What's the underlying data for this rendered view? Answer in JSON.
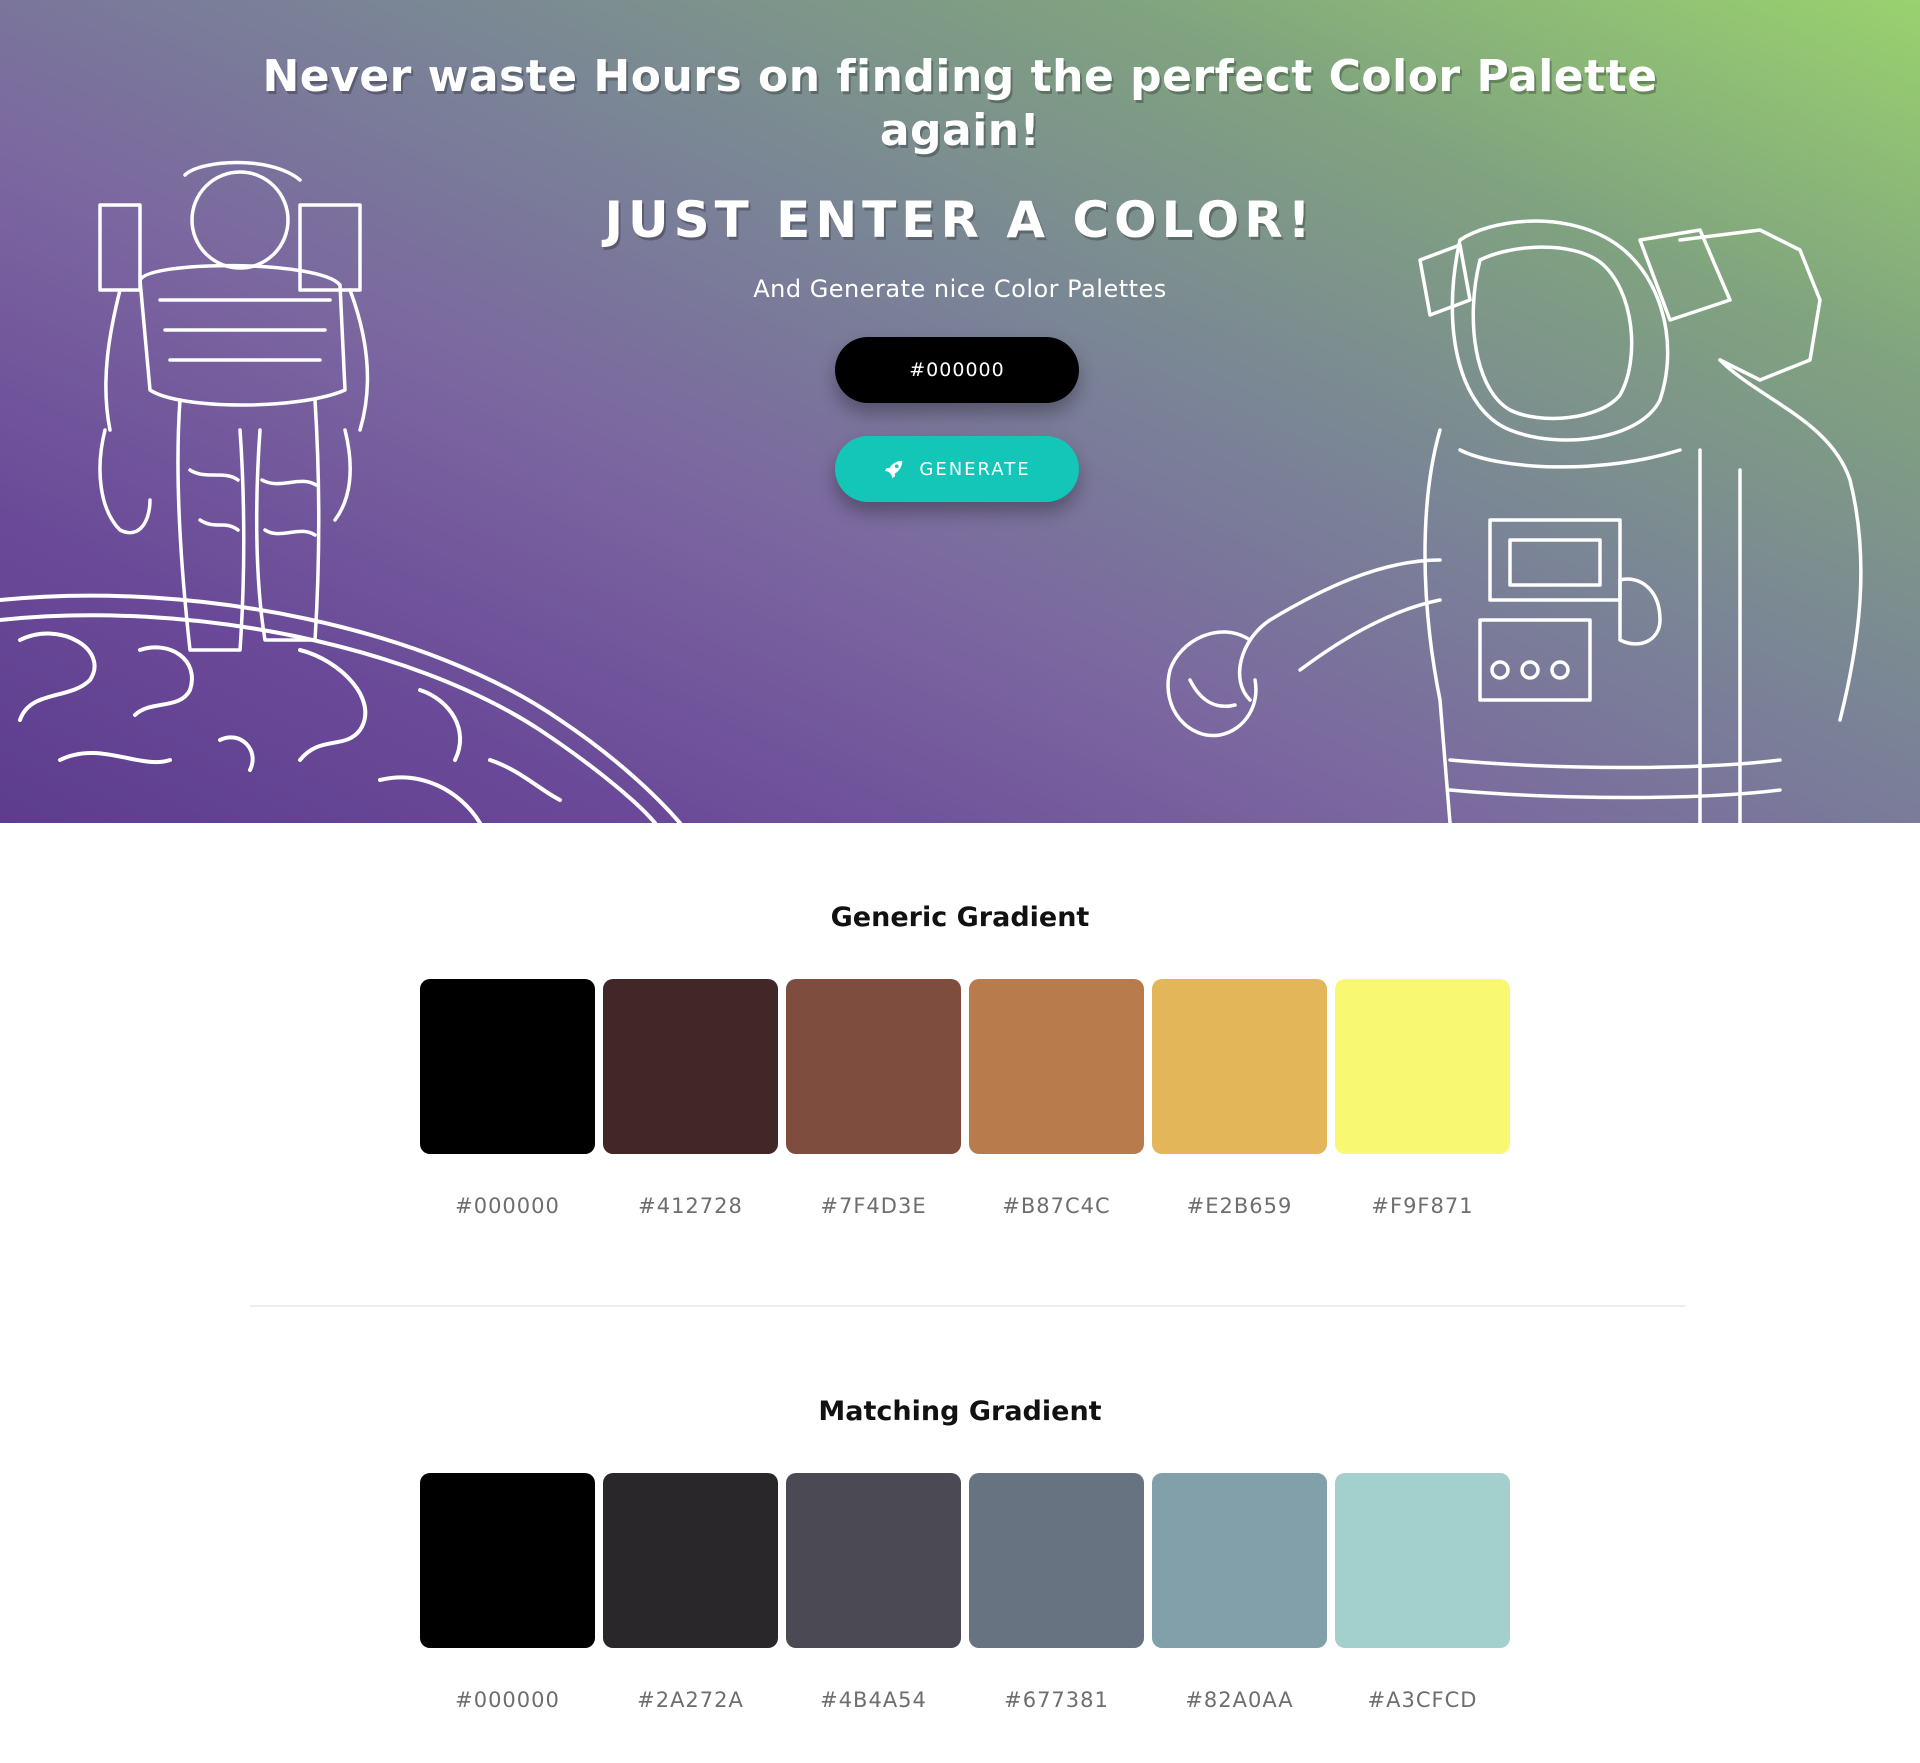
{
  "hero": {
    "headline": "Never waste Hours on finding the perfect Color Palette again!",
    "subheadline": "JUST ENTER A COLOR!",
    "tagline": "And Generate nice Color Palettes",
    "input_value": "#000000",
    "generate_label": "GENERATE",
    "generate_icon": "rocket-icon"
  },
  "generic": {
    "title": "Generic Gradient",
    "swatches": [
      {
        "hex": "#000000",
        "label": "#000000"
      },
      {
        "hex": "#412728",
        "label": "#412728"
      },
      {
        "hex": "#7F4D3E",
        "label": "#7F4D3E"
      },
      {
        "hex": "#B87C4C",
        "label": "#B87C4C"
      },
      {
        "hex": "#E2B659",
        "label": "#E2B659"
      },
      {
        "hex": "#F9F871",
        "label": "#F9F871"
      }
    ]
  },
  "matching": {
    "title": "Matching Gradient",
    "swatches": [
      {
        "hex": "#000000",
        "label": "#000000"
      },
      {
        "hex": "#2A272A",
        "label": "#2A272A"
      },
      {
        "hex": "#4B4A54",
        "label": "#4B4A54"
      },
      {
        "hex": "#677381",
        "label": "#677381"
      },
      {
        "hex": "#82A0AA",
        "label": "#82A0AA"
      },
      {
        "hex": "#A3CFCD",
        "label": "#A3CFCD"
      }
    ]
  },
  "colors": {
    "accent": "#13c6b7",
    "gradient_start": "#5d3c8e",
    "gradient_end": "#9ad26e"
  }
}
